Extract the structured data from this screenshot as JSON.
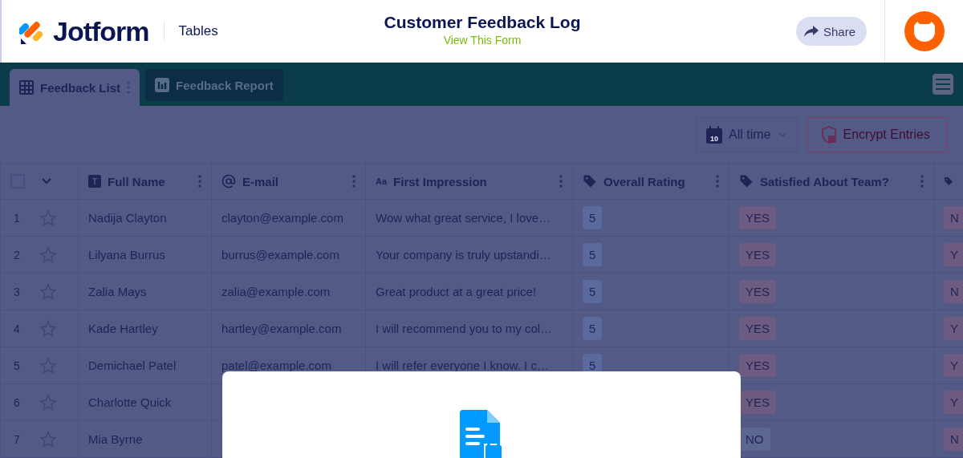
{
  "header": {
    "logo": "Jotform",
    "product": "Tables",
    "title": "Customer Feedback Log",
    "form_link": "View This Form",
    "share_button": "Share"
  },
  "tabs": [
    {
      "label": "Feedback List",
      "kind": "table",
      "selected": true
    },
    {
      "label": "Feedback Report",
      "kind": "report",
      "selected": false
    }
  ],
  "toolbar": {
    "date_filter": "All time",
    "date_icon_day": "10",
    "encrypt_button": "Encrypt Entries"
  },
  "table": {
    "select_all_checked": false,
    "columns": [
      {
        "label": "Full Name",
        "kind": "text",
        "icon": "T"
      },
      {
        "label": "E-mail",
        "kind": "email"
      },
      {
        "label": "First Impression",
        "kind": "text",
        "icon": "Aa"
      },
      {
        "label": "Overall Rating",
        "kind": "tag"
      },
      {
        "label": "Satisfied About Team?",
        "kind": "tag"
      },
      {
        "kind": "tag"
      }
    ],
    "rows": [
      {
        "number": "1",
        "starred": false,
        "cells": [
          "Nadija Clayton",
          "clayton@example.com",
          "Wow what great service, I love…",
          {
            "text": "5",
            "color": "#5a6a9c"
          },
          {
            "text": "YES",
            "color": "#6e5b82"
          },
          {
            "text": "N",
            "color": "#6e5b82"
          }
        ]
      },
      {
        "number": "2",
        "starred": false,
        "cells": [
          "Lilyana Burrus",
          "burrus@example.com",
          "Your company is truly upstandi…",
          {
            "text": "5",
            "color": "#5a6a9c"
          },
          {
            "text": "YES",
            "color": "#6e5b82"
          },
          {
            "text": "Y",
            "color": "#6e5b82"
          }
        ]
      },
      {
        "number": "3",
        "starred": false,
        "cells": [
          "Zalia Mays",
          "zalia@example.com",
          "Great product at a great price!",
          {
            "text": "5",
            "color": "#5a6a9c"
          },
          {
            "text": "YES",
            "color": "#6e5b82"
          },
          {
            "text": "N",
            "color": "#6e5b82"
          }
        ]
      },
      {
        "number": "4",
        "starred": false,
        "cells": [
          "Kade Hartley",
          "hartley@example.com",
          "I will recommend you to my col…",
          {
            "text": "5",
            "color": "#5a6a9c"
          },
          {
            "text": "YES",
            "color": "#6e5b82"
          },
          {
            "text": "Y",
            "color": "#6e5b82"
          }
        ]
      },
      {
        "number": "5",
        "starred": false,
        "cells": [
          "Demichael Patel",
          "patel@example.com",
          "I will refer everyone I know. I c…",
          {
            "text": "5",
            "color": "#5a6a9c"
          },
          {
            "text": "YES",
            "color": "#6e5b82"
          },
          {
            "text": "Y",
            "color": "#6e5b82"
          }
        ]
      },
      {
        "number": "6",
        "starred": false,
        "cells": [
          "Charlotte Quick",
          null,
          null,
          null,
          {
            "text": "YES",
            "color": "#6e5b82"
          },
          {
            "text": "Y",
            "color": "#6e5b82"
          }
        ]
      },
      {
        "number": "7",
        "starred": false,
        "cells": [
          "Mia Byrne",
          null,
          null,
          null,
          {
            "text": "NO",
            "color": "#5d6690"
          },
          {
            "text": "N",
            "color": "#6e5b82"
          }
        ]
      }
    ]
  },
  "dialog": {
    "visible": true
  }
}
